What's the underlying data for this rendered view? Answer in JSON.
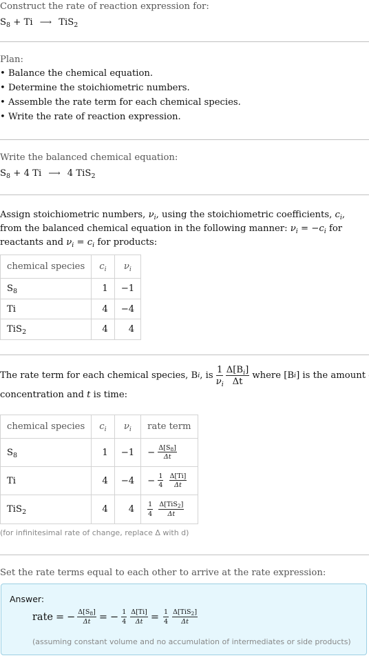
{
  "intro": {
    "label": "Construct the rate of reaction expression for:",
    "reaction": {
      "reactants": [
        {
          "coef": "",
          "species": "S",
          "sub": "8"
        },
        {
          "coef": "",
          "species": "Ti",
          "sub": ""
        }
      ],
      "products": [
        {
          "coef": "",
          "species": "TiS",
          "sub": "2"
        }
      ],
      "plus": "+",
      "arrow": "⟶"
    }
  },
  "plan": {
    "label": "Plan:",
    "bullet": "•",
    "items": [
      "Balance the chemical equation.",
      "Determine the stoichiometric numbers.",
      "Assemble the rate term for each chemical species.",
      "Write the rate of reaction expression."
    ]
  },
  "balanced": {
    "label": "Write the balanced chemical equation:",
    "ti_coef": "4",
    "tis2_coef": "4"
  },
  "stoich": {
    "text_1": "Assign stoichiometric numbers, ",
    "nu": "ν",
    "i": "i",
    "text_2": ", using the stoichiometric coefficients, ",
    "c": "c",
    "text_3": ", from the balanced chemical equation in the following manner: ",
    "text_4": " for reactants and ",
    "text_5": " for products:",
    "eq_reactants": " = −",
    "eq_products": " = ",
    "table": {
      "headers": [
        "chemical species",
        "c",
        "ν"
      ],
      "rows": [
        {
          "species": "S",
          "sub": "8",
          "c": "1",
          "nu": "−1"
        },
        {
          "species": "Ti",
          "sub": "",
          "c": "4",
          "nu": "−4"
        },
        {
          "species": "TiS",
          "sub": "2",
          "c": "4",
          "nu": "4"
        }
      ]
    }
  },
  "rate_terms": {
    "text_1": "The rate term for each chemical species, B",
    "text_2": ", is ",
    "frac_num_left": "1",
    "frac_num_right": "Δ[B",
    "frac_den_right": "Δt",
    "text_3": " where [B",
    "text_4": "] is the amount concentration and ",
    "t": "t",
    "text_5": " is time:",
    "table": {
      "headers": [
        "chemical species",
        "c",
        "ν",
        "rate term"
      ],
      "rows": [
        {
          "species": "S",
          "sub": "8",
          "c": "1",
          "nu": "−1",
          "sign": "−",
          "coef": "",
          "num": "Δ[S",
          "numsub": "8",
          "den": "Δt"
        },
        {
          "species": "Ti",
          "sub": "",
          "c": "4",
          "nu": "−4",
          "sign": "−",
          "coef": "4",
          "num": "Δ[Ti]",
          "numsub": "",
          "den": "Δt"
        },
        {
          "species": "TiS",
          "sub": "2",
          "c": "4",
          "nu": "4",
          "sign": "",
          "coef": "4",
          "num": "Δ[TiS",
          "numsub": "2",
          "den": "Δt"
        }
      ]
    },
    "note": "(for infinitesimal rate of change, replace Δ with d)"
  },
  "final": {
    "label": "Set the rate terms equal to each other to arrive at the rate expression:",
    "answer_label": "Answer:",
    "rate_word": "rate",
    "equals": "=",
    "minus": "−",
    "one": "1",
    "four": "4",
    "s8_num": "Δ[S",
    "s8_sub": "8",
    "ti_num": "Δ[Ti]",
    "tis2_num": "Δ[TiS",
    "tis2_sub": "2",
    "den": "Δt",
    "close_bracket": "]",
    "note": "(assuming constant volume and no accumulation of intermediates or side products)"
  }
}
